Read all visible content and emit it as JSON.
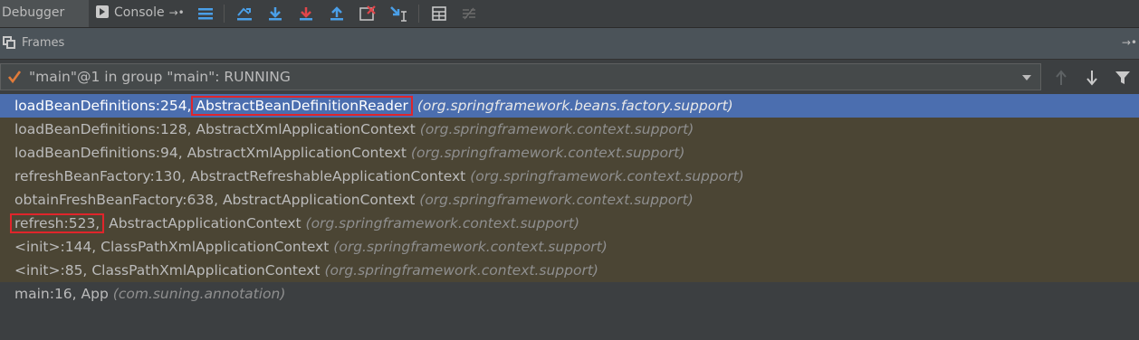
{
  "toolbar": {
    "tabs": [
      {
        "label": "Debugger",
        "active": true
      },
      {
        "label": "Console",
        "active": false
      }
    ],
    "icons": [
      "menu-icon",
      "show-execution-point-icon",
      "step-over-icon",
      "step-into-icon",
      "force-step-into-icon",
      "step-out-icon",
      "drop-frame-icon",
      "run-to-cursor-icon",
      "evaluate-expression-icon",
      "trace-icon"
    ]
  },
  "frames_panel": {
    "title": "Frames"
  },
  "thread": {
    "label": "\"main\"@1 in group \"main\": RUNNING"
  },
  "frames": [
    {
      "method": "loadBeanDefinitions:254,",
      "class": "AbstractBeanDefinitionReader",
      "package": "(org.springframework.beans.factory.support)",
      "selected": true,
      "highlight": "class"
    },
    {
      "method": "loadBeanDefinitions:128,",
      "class": "AbstractXmlApplicationContext",
      "package": "(org.springframework.context.support)"
    },
    {
      "method": "loadBeanDefinitions:94,",
      "class": "AbstractXmlApplicationContext",
      "package": "(org.springframework.context.support)"
    },
    {
      "method": "refreshBeanFactory:130,",
      "class": "AbstractRefreshableApplicationContext",
      "package": "(org.springframework.context.support)"
    },
    {
      "method": "obtainFreshBeanFactory:638,",
      "class": "AbstractApplicationContext",
      "package": "(org.springframework.context.support)"
    },
    {
      "method": "refresh:523,",
      "class": "AbstractApplicationContext",
      "package": "(org.springframework.context.support)",
      "highlight": "method"
    },
    {
      "method": "<init>:144,",
      "class": "ClassPathXmlApplicationContext",
      "package": "(org.springframework.context.support)"
    },
    {
      "method": "<init>:85,",
      "class": "ClassPathXmlApplicationContext",
      "package": "(org.springframework.context.support)"
    },
    {
      "method": "main:16,",
      "class": "App",
      "package": "(com.suning.annotation)",
      "plain": true
    }
  ],
  "colors": {
    "selected_row": "#4b6eaf",
    "library_row": "#4b4534",
    "highlight_box": "#e0252b",
    "check": "#e07b3a"
  }
}
